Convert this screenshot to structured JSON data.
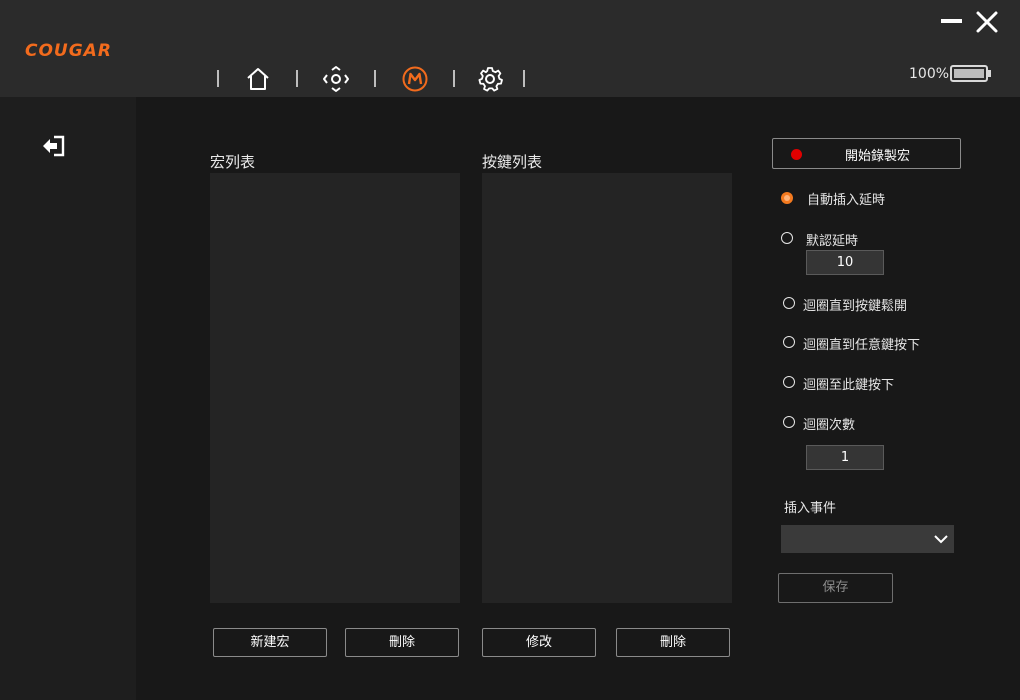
{
  "app": {
    "logo_text": "COUGAR",
    "accent_color": "#f26b1d"
  },
  "window": {
    "minimize_icon": "minimize-icon",
    "close_icon": "close-icon"
  },
  "nav": {
    "items": [
      {
        "name": "home",
        "icon": "home-icon"
      },
      {
        "name": "dpi",
        "icon": "dpi-crosshair-icon"
      },
      {
        "name": "macro",
        "icon": "macro-m-icon",
        "active": true
      },
      {
        "name": "settings",
        "icon": "gear-icon"
      }
    ]
  },
  "battery": {
    "percent_label": "100%",
    "level": 1.0
  },
  "sidebar": {
    "logout_icon": "logout-icon"
  },
  "macro_list": {
    "title": "宏列表",
    "new_button": "新建宏",
    "delete_button": "刪除"
  },
  "key_list": {
    "title": "按鍵列表",
    "edit_button": "修改",
    "delete_button": "刪除"
  },
  "record": {
    "button_label": "開始錄製宏",
    "dot_color": "#e00000"
  },
  "delay_options": [
    {
      "label": "自動插入延時",
      "selected": true
    },
    {
      "label": "默認延時",
      "selected": false
    }
  ],
  "default_delay_value": "10",
  "loop_options": [
    {
      "label": "迴圈直到按鍵鬆開",
      "selected": false
    },
    {
      "label": "迴圈直到任意鍵按下",
      "selected": false
    },
    {
      "label": "迴圈至此鍵按下",
      "selected": false
    },
    {
      "label": "迴圈次數",
      "selected": false
    }
  ],
  "loop_count_value": "1",
  "insert_event": {
    "label": "插入事件",
    "selected_value": ""
  },
  "save_button": "保存"
}
